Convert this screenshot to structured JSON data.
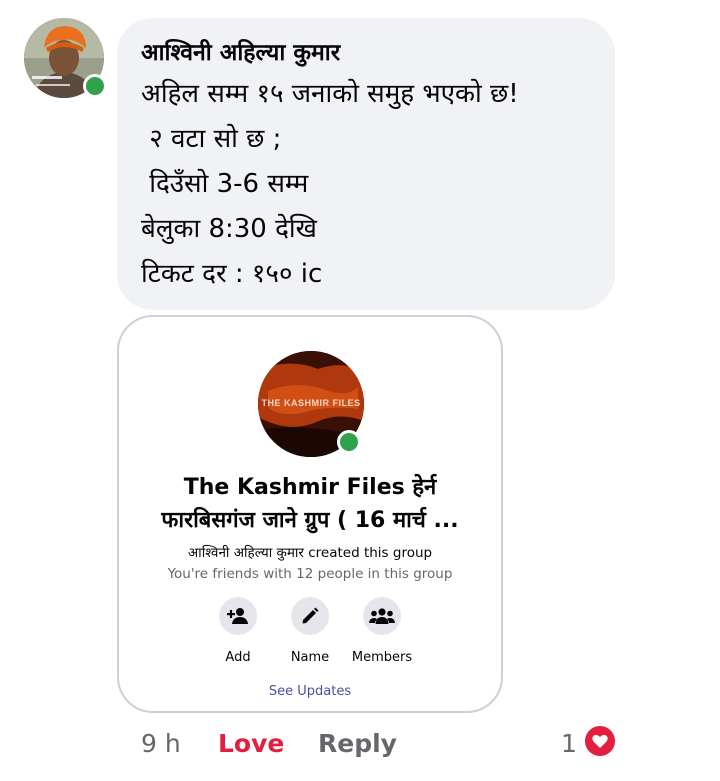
{
  "comment": {
    "author": "आश्विनी अहिल्या कुमार",
    "lines": [
      "अहिल सम्म १५ जनाको समुह भएको छ!",
      " २ वटा सो छ ;",
      " दिउँसो 3-6 सम्म",
      "बेलुका 8:30 देखि",
      "टिकट दर : १५० ic"
    ]
  },
  "group_card": {
    "poster_title": "THE KASHMIR FILES",
    "title_line1": "The Kashmir Files हेर्न",
    "title_line2": "फारबिसगंज जाने ग्रुप ( 16 मार्च ...",
    "creator_line": "आश्विनी अहिल्या कुमार created this group",
    "friends_line": "You're friends with 12 people in this group",
    "actions": [
      {
        "label": "Add",
        "icon": "add-person-icon"
      },
      {
        "label": "Name",
        "icon": "pencil-icon"
      },
      {
        "label": "Members",
        "icon": "members-icon"
      }
    ],
    "see_updates": "See Updates"
  },
  "footer": {
    "time": "9 h",
    "love": "Love",
    "reply": "Reply",
    "reaction_count": "1",
    "reaction_icon": "heart-icon"
  },
  "colors": {
    "bubble": "#f0f2f5",
    "online": "#31a24c",
    "love": "#e41e3f",
    "muted": "#65676b",
    "link": "#4b4f9e"
  }
}
